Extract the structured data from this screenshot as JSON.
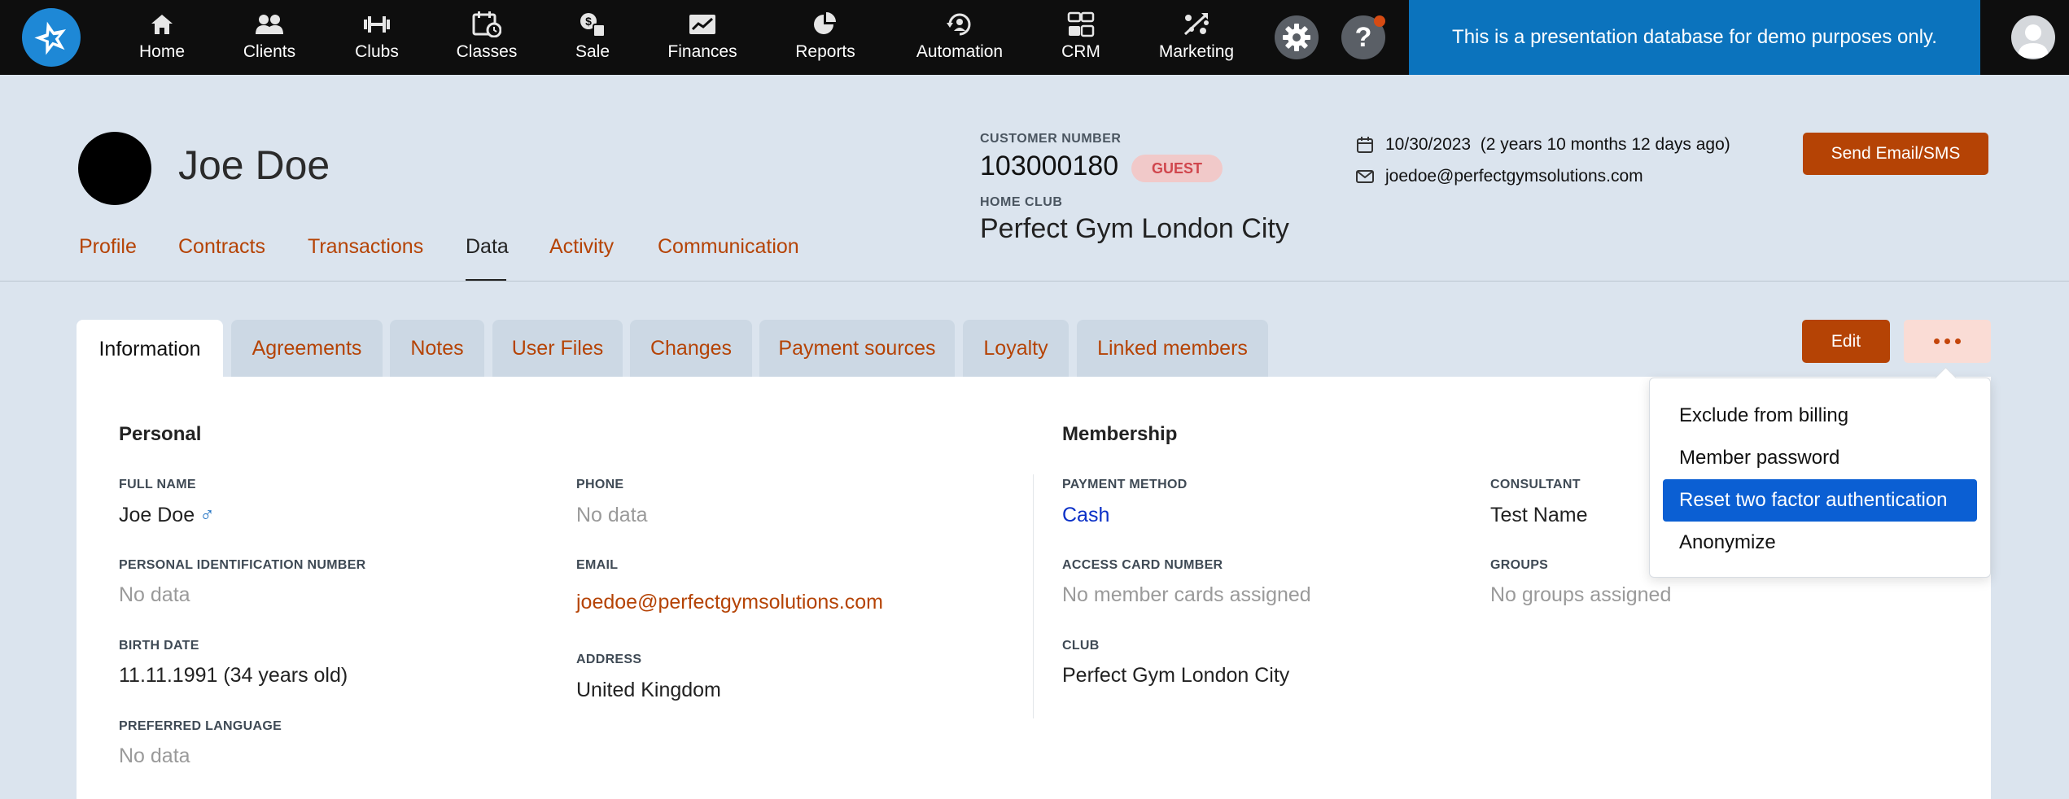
{
  "nav": {
    "items": [
      {
        "label": "Home",
        "icon": "home-icon"
      },
      {
        "label": "Clients",
        "icon": "clients-icon"
      },
      {
        "label": "Clubs",
        "icon": "clubs-icon"
      },
      {
        "label": "Classes",
        "icon": "classes-icon"
      },
      {
        "label": "Sale",
        "icon": "sale-icon"
      },
      {
        "label": "Finances",
        "icon": "finances-icon"
      },
      {
        "label": "Reports",
        "icon": "reports-icon"
      },
      {
        "label": "Automation",
        "icon": "automation-icon"
      },
      {
        "label": "CRM",
        "icon": "crm-icon"
      },
      {
        "label": "Marketing",
        "icon": "marketing-icon"
      }
    ],
    "settings_icon": "gear-icon",
    "help_icon": "question-icon",
    "help_glyph": "?",
    "banner": "This is a presentation database for demo purposes only."
  },
  "header": {
    "name": "Joe Doe",
    "customer_number_label": "CUSTOMER NUMBER",
    "customer_number": "103000180",
    "status_badge": "GUEST",
    "home_club_label": "HOME CLUB",
    "home_club": "Perfect Gym London City",
    "date": "10/30/2023  (2 years 10 months 12 days ago)",
    "email": "joedoe@perfectgymsolutions.com",
    "send_button": "Send Email/SMS"
  },
  "main_tabs": [
    "Profile",
    "Contracts",
    "Transactions",
    "Data",
    "Activity",
    "Communication"
  ],
  "active_main_tab": "Data",
  "sub_tabs": [
    "Information",
    "Agreements",
    "Notes",
    "User Files",
    "Changes",
    "Payment sources",
    "Loyalty",
    "Linked members"
  ],
  "active_sub_tab": "Information",
  "actions": {
    "edit": "Edit"
  },
  "personal": {
    "title": "Personal",
    "full_name_label": "FULL NAME",
    "full_name": "Joe Doe",
    "gender_glyph": "♂",
    "pin_label": "PERSONAL IDENTIFICATION NUMBER",
    "pin": "No data",
    "birth_label": "BIRTH DATE",
    "birth": "11.11.1991 (34 years old)",
    "lang_label": "PREFERRED LANGUAGE",
    "lang": "No data",
    "phone_label": "PHONE",
    "phone": "No data",
    "email_label": "EMAIL",
    "email": "joedoe@perfectgymsolutions.com",
    "address_label": "ADDRESS",
    "address": "United Kingdom"
  },
  "membership": {
    "title": "Membership",
    "payment_label": "PAYMENT METHOD",
    "payment": "Cash",
    "card_label": "ACCESS CARD NUMBER",
    "card": "No member cards assigned",
    "club_label": "CLUB",
    "club": "Perfect Gym London City",
    "consultant_label": "CONSULTANT",
    "consultant": "Test Name",
    "groups_label": "GROUPS",
    "groups": "No groups assigned"
  },
  "dropdown": {
    "items": [
      "Exclude from billing",
      "Member password",
      "Reset two factor authentication",
      "Anonymize"
    ],
    "selected": "Reset two factor authentication"
  }
}
